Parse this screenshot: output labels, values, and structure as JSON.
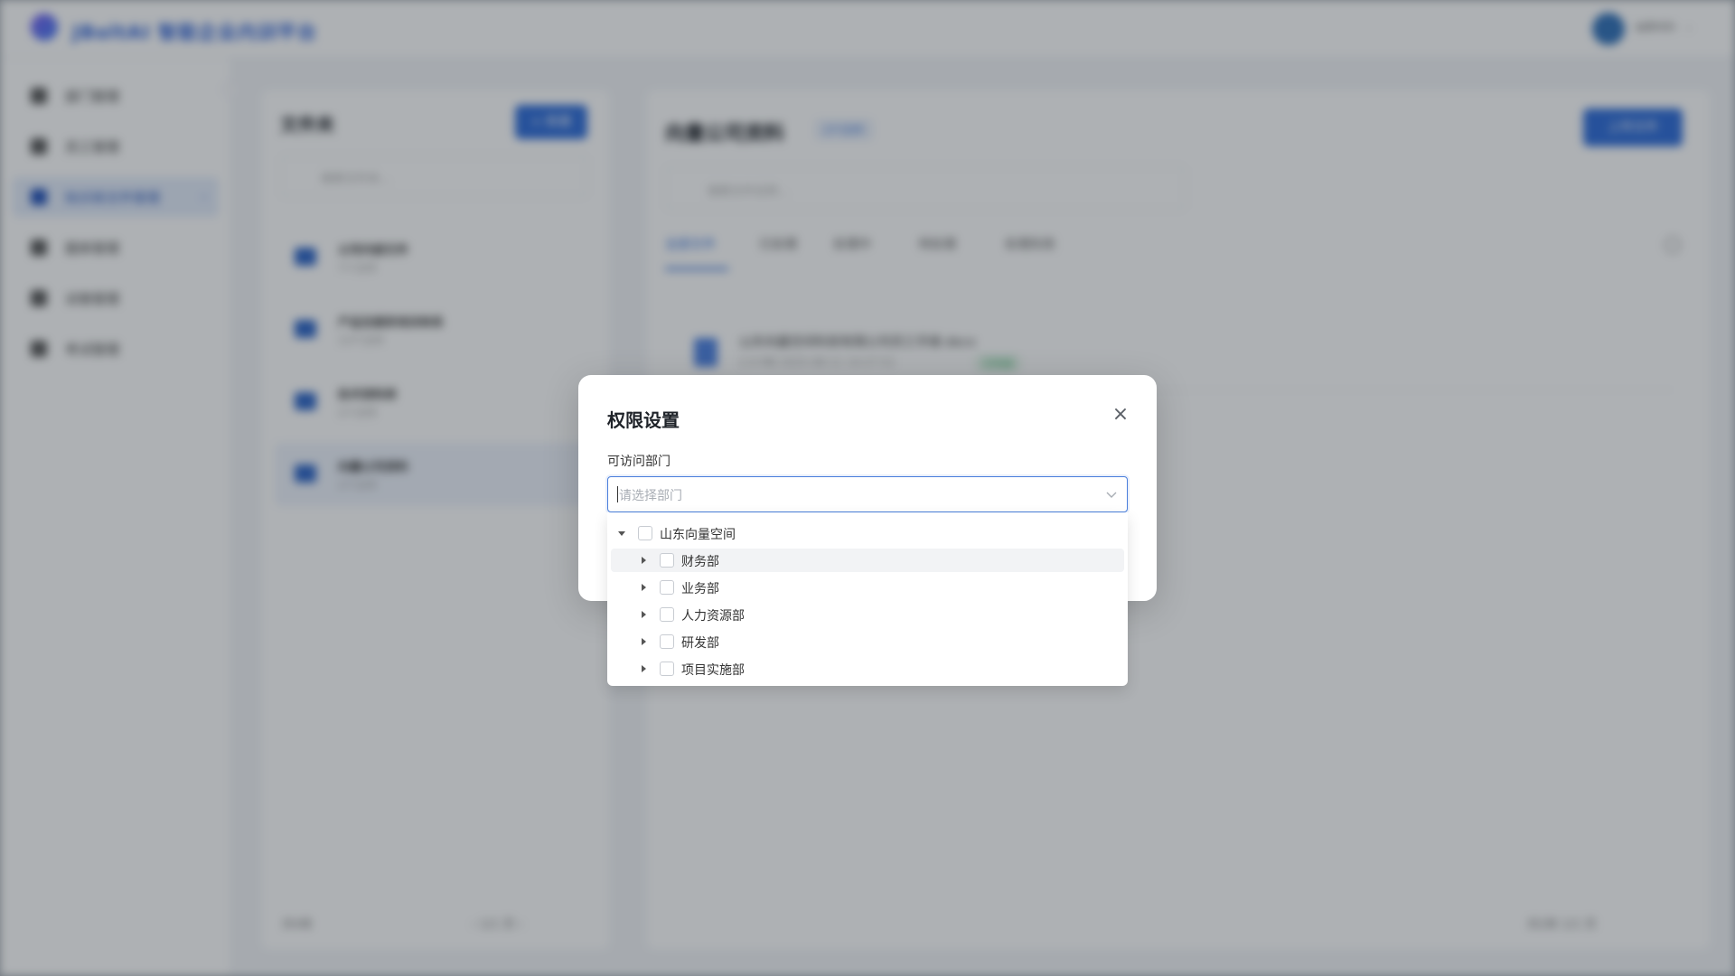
{
  "app": {
    "title": "JBoltAI 智能企业内训平台",
    "user": "admin"
  },
  "sidebar": {
    "items": [
      {
        "label": "部门管理"
      },
      {
        "label": "员工管理"
      },
      {
        "label": "知识库文件管理"
      },
      {
        "label": "题库管理"
      },
      {
        "label": "试卷管理"
      },
      {
        "label": "考试管理"
      }
    ],
    "active_index": 2
  },
  "kb_panel": {
    "title": "文件夹",
    "new_button": "+ 新建",
    "search_placeholder": "搜索文件夹...",
    "folders": [
      {
        "name": "公司内部文件",
        "count": "7个文件"
      },
      {
        "name": "产品及服务培训体系",
        "count": "13个文件"
      },
      {
        "name": "技术资料库",
        "count": "2个文件"
      },
      {
        "name": "向量公司资料",
        "count": "2个文件"
      }
    ],
    "active_index": 3,
    "total": "共4条",
    "pager": "‹  1/1 页  ›"
  },
  "doc_panel": {
    "title": "向量公司资料",
    "badge": "2个文件",
    "upload_button": "上传文件",
    "search_placeholder": "搜索文件名称...",
    "tabs": [
      "全部文件",
      "已处理",
      "处理中",
      "待处理",
      "处理失败"
    ],
    "row": {
      "name": "山东向量空间科技有限公司员工手册.docx",
      "meta": "2.9 MB   2025-08-11 14:27:51",
      "status": "已完成"
    },
    "footer": "共2条   1/1 页"
  },
  "modal": {
    "title": "权限设置",
    "close_glyph": "×",
    "field_label": "可访问部门",
    "select_placeholder": "请选择部门",
    "tree": [
      {
        "label": "山东向量空间",
        "level": 0,
        "expanded": true
      },
      {
        "label": "财务部",
        "level": 1,
        "expanded": false
      },
      {
        "label": "业务部",
        "level": 1,
        "expanded": false
      },
      {
        "label": "人力资源部",
        "level": 1,
        "expanded": false
      },
      {
        "label": "研发部",
        "level": 1,
        "expanded": false
      },
      {
        "label": "项目实施部",
        "level": 1,
        "expanded": false
      }
    ],
    "hover_index": 1
  },
  "icons": {
    "close": "close-icon",
    "select_arrow": "chevron-down-icon",
    "tree_expanded": "caret-down-icon",
    "tree_collapsed": "caret-right-icon"
  },
  "colors": {
    "accent": "#4a7fdc",
    "overlay": "rgba(30,38,48,0.36)"
  }
}
